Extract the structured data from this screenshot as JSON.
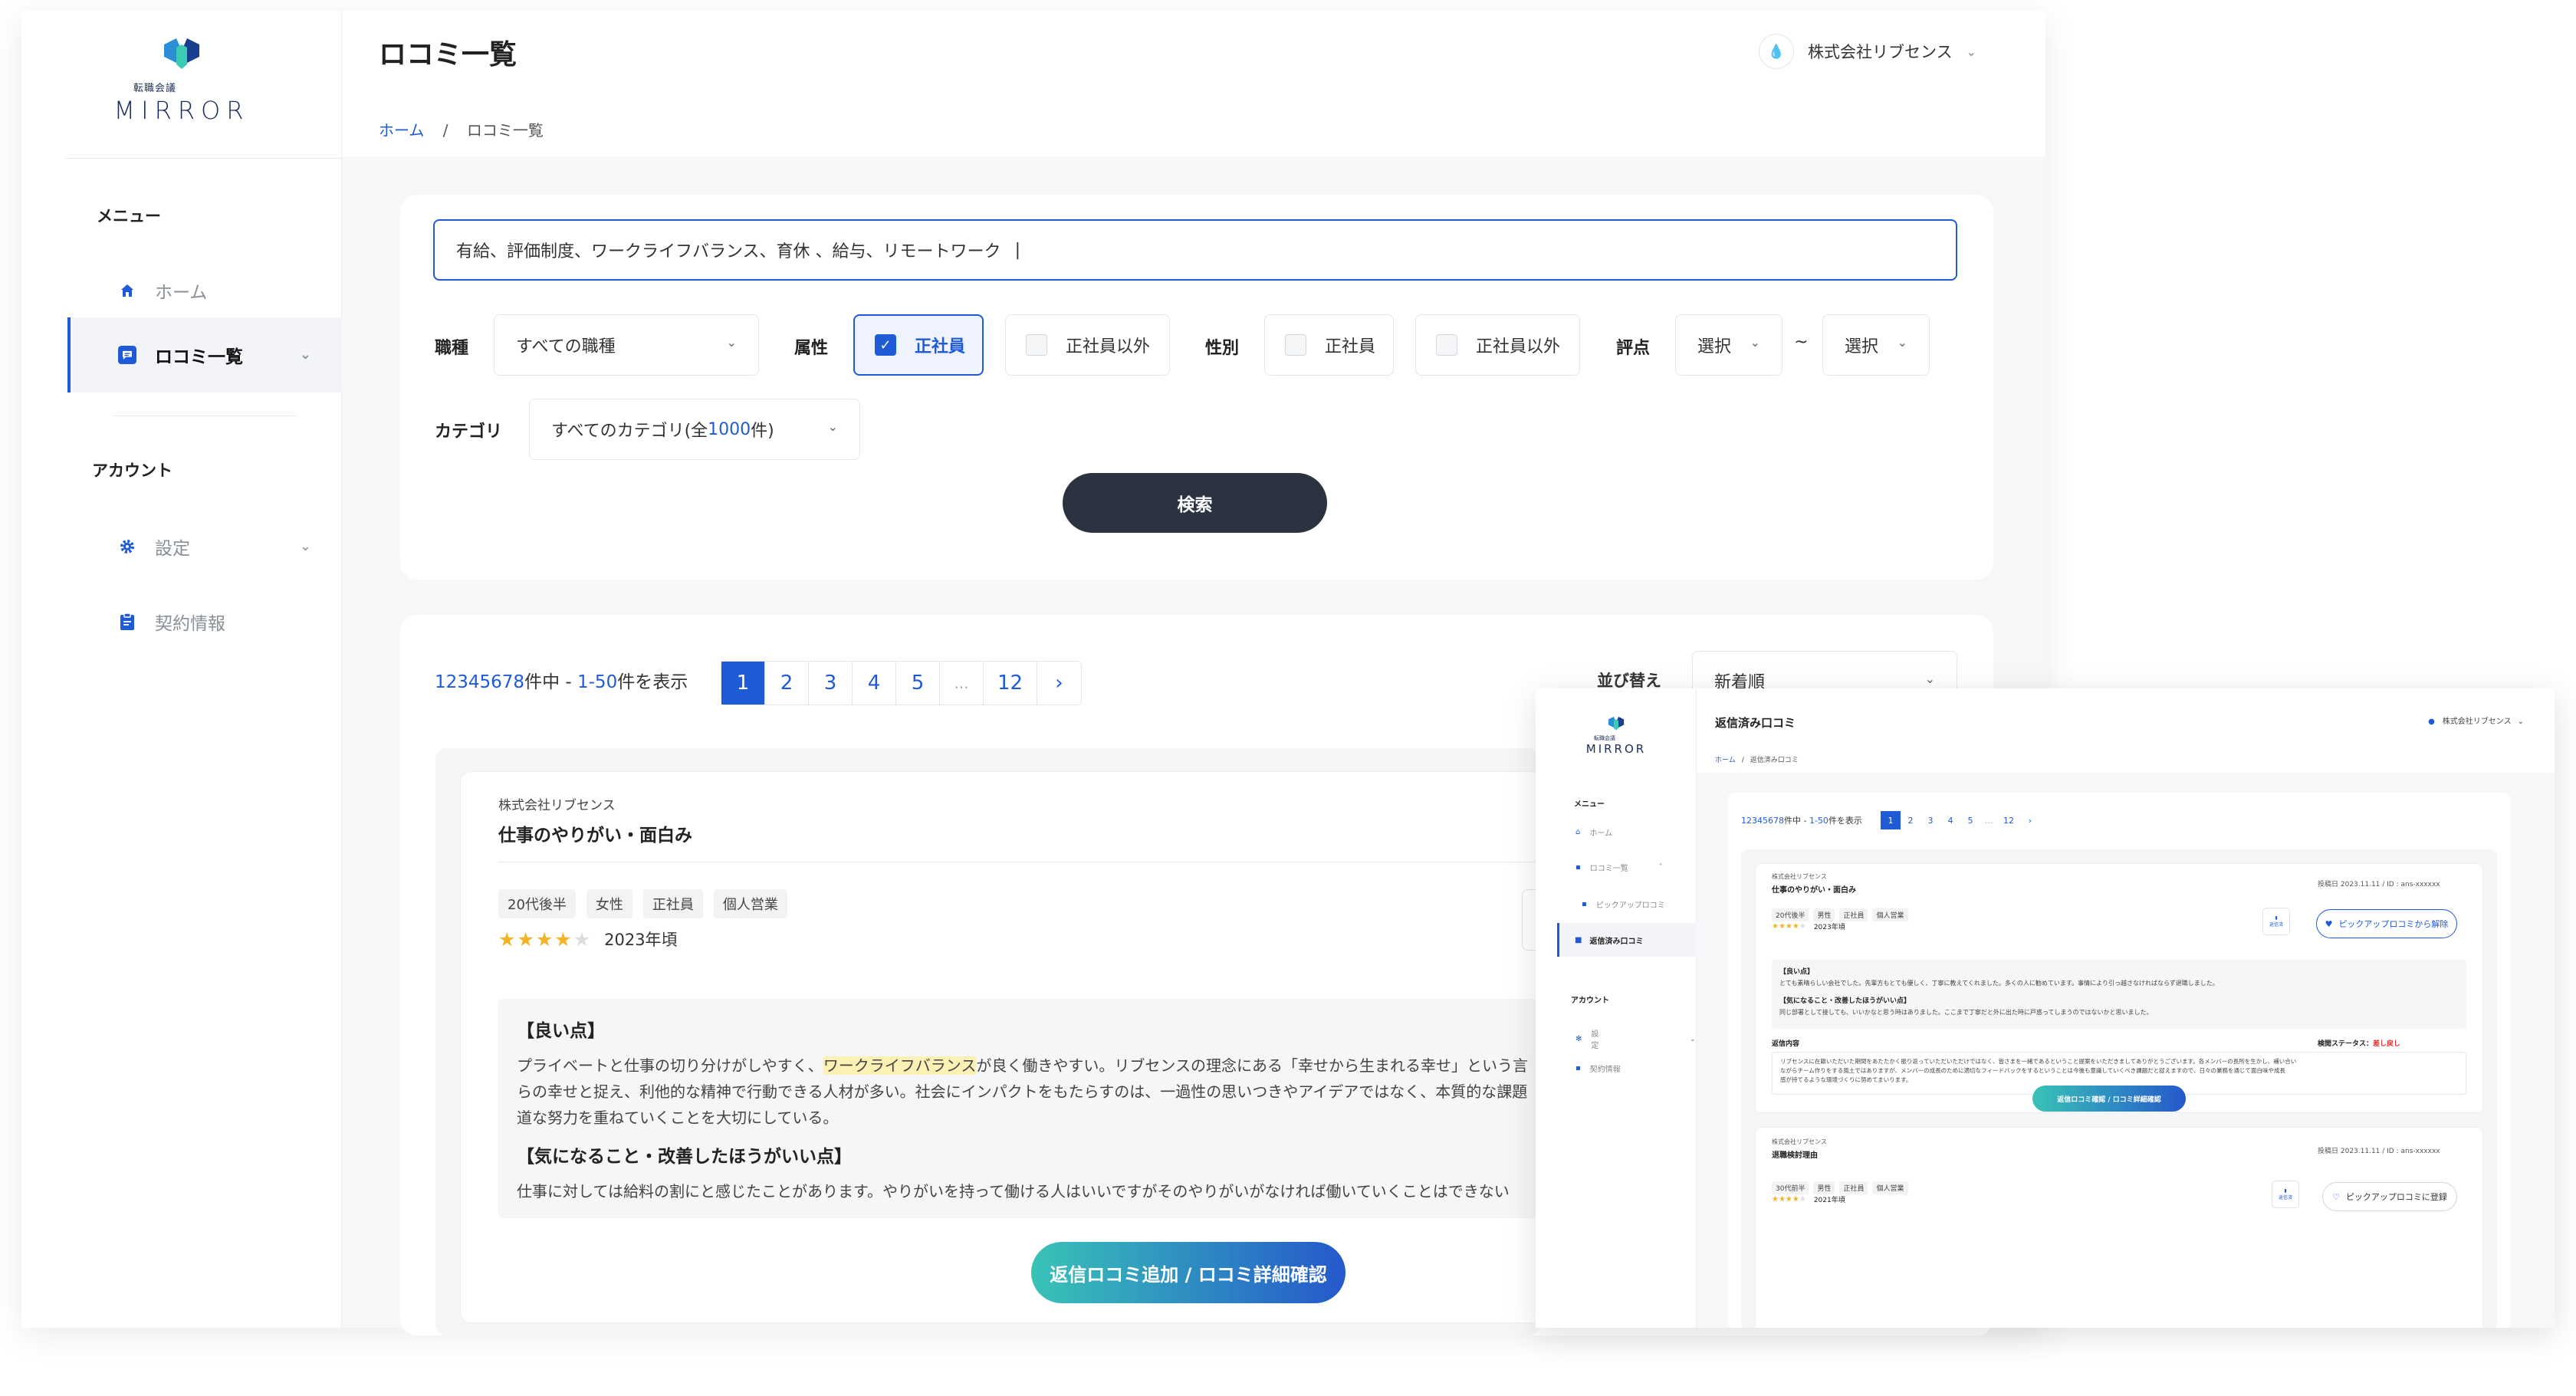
{
  "brand": {
    "sub": "転職会議",
    "name": "MIRROR"
  },
  "sidebar": {
    "menu_heading": "メニュー",
    "items": [
      {
        "label": "ホーム"
      },
      {
        "label": "ロコミ一覧"
      }
    ],
    "account_heading": "アカウント",
    "account_items": [
      {
        "label": "設定"
      },
      {
        "label": "契約情報"
      }
    ]
  },
  "header": {
    "title": "ロコミ一覧",
    "company": "株式会社リブセンス",
    "breadcrumb": {
      "home": "ホーム",
      "sep": "/",
      "current": "ロコミ一覧"
    }
  },
  "search": {
    "query": "有給、評価制度、ワークライフバランス、育休 、給与、リモートワーク",
    "job_label": "職種",
    "job_value": "すべての職種",
    "attr_label": "属性",
    "attr_opt1": "正社員",
    "attr_opt2": "正社員以外",
    "gender_label": "性別",
    "gender_opt1": "正社員",
    "gender_opt2": "正社員以外",
    "score_label": "評点",
    "score_from": "選択",
    "tilde": "~",
    "score_to": "選択",
    "category_label": "カテゴリ",
    "category_value_pre": "すべてのカテゴリ(全",
    "category_value_num": "1000",
    "category_value_post": "件)",
    "button": "検索"
  },
  "results": {
    "total": "12345678",
    "count_mid": "件中 - ",
    "range": "1-50",
    "count_post": "件を表示",
    "pages": [
      "1",
      "2",
      "3",
      "4",
      "5",
      "...",
      "12",
      "›"
    ],
    "sort_label": "並び替え",
    "sort_value": "新着順"
  },
  "review": {
    "company": "株式会社リブセンス",
    "title": "仕事のやりがい・面白み",
    "tags": [
      "20代後半",
      "女性",
      "正社員",
      "個人営業"
    ],
    "rating": 4,
    "year": "2023年頃",
    "good_heading": "【良い点】",
    "good_pre": "プライベートと仕事の切り分けがしやすく、",
    "good_hl": "ワークライフバランス",
    "good_post": "が良く働きやすい。リブセンスの理念にある「幸せから生まれる幸せ」という言",
    "good_line2": "らの幸せと捉え、利他的な精神で行動できる人材が多い。社会にインパクトをもたらすのは、一過性の思いつきやアイデアではなく、本質的な課題",
    "good_line3": "道な努力を重ねていくことを大切にしている。",
    "bad_heading": "【気になること・改善したほうがいい点】",
    "bad_text": "仕事に対しては給料の割にと感じたことがあります。やりがいを持って働ける人はいいですがそのやりがいがなければ働いていくことはできない",
    "action": "返信ロコミ追加 / ロコミ詳細確認"
  },
  "win2": {
    "title": "返信済み口コミ",
    "company": "株式会社リブセンス",
    "crumb_home": "ホーム",
    "crumb_sep": "/",
    "crumb_current": "返信済み口コミ",
    "menu_heading": "メニュー",
    "nav_home": "ホーム",
    "nav_reviews": "ロコミ一覧",
    "nav_pickup": "ピックアップロコミ",
    "nav_replied": "返信済み口コミ",
    "account_heading": "アカウント",
    "nav_settings": "設定",
    "nav_contract": "契約情報",
    "count_total": "12345678",
    "count_mid": "件中 - ",
    "count_range": "1-50",
    "count_post": "件を表示",
    "pages": [
      "1",
      "2",
      "3",
      "4",
      "5",
      "...",
      "12",
      "›"
    ],
    "card1": {
      "company": "株式会社リブセンス",
      "title": "仕事のやりがい・面白み",
      "meta": "投稿日 2023.11.11 / ID : ans-xxxxxx",
      "tags": [
        "20代後半",
        "男性",
        "正社員",
        "個人営業"
      ],
      "year": "2023年頃",
      "icon_label": "返信済",
      "pickup_button": "ピックアップロコミから解除",
      "good_heading": "【良い点】",
      "good_text": "とても素晴らしい会社でした。先輩方もとても優しく、丁寧に教えてくれました。多くの人に勧めています。事情により引っ越さなければならず退職しました。",
      "bad_heading": "【気になること・改善したほうがいい点】",
      "bad_text": "同じ部署として接しても、いいかなと思う時はありました。ここまで丁寧だと外に出た時に戸惑ってしまうのではないかと思いました。",
      "reply_label": "返信内容",
      "status_label": "検閲ステータス：",
      "status_value": "差し戻し",
      "reply_text1": "リブセンスに在籍いただいた期間をあたたかく振り返っていただいただけではなく、皆さまを一緒であるということ提案をいただきましてありがとうございます。各メンバーの長所を生かし、補い合い",
      "reply_text2": "ながらチーム作りをする風土ではありますが、メンバーの成長のために適切なフィードバックをするということは今後も意識していくべき課題だと捉えますので、日々の業務を通じて面白味や成長",
      "reply_text3": "感が持てるような環境づくりに努めてまいります。",
      "action": "返信ロコミ確認 / ロコミ詳細確認"
    },
    "card2": {
      "company": "株式会社リブセンス",
      "title": "退職検討理由",
      "meta": "投稿日 2023.11.11 / ID : ans-xxxxxx",
      "tags": [
        "30代前半",
        "男性",
        "正社員",
        "個人営業"
      ],
      "year": "2021年頃",
      "icon_label": "返信済",
      "pickup_button": "ピックアップロコミに登録"
    }
  },
  "colors": {
    "accent": "#1f5bd6",
    "dark_button": "#2c3340",
    "gradient_start": "#39c3b7",
    "gradient_end": "#2558cc",
    "star": "#f2b324",
    "status_red": "#e0312d"
  },
  "icons": [
    "home-icon",
    "chat-icon",
    "gear-icon",
    "clipboard-icon",
    "chevron-down-icon",
    "check-icon",
    "star-icon",
    "heart-icon",
    "reply-icon"
  ]
}
